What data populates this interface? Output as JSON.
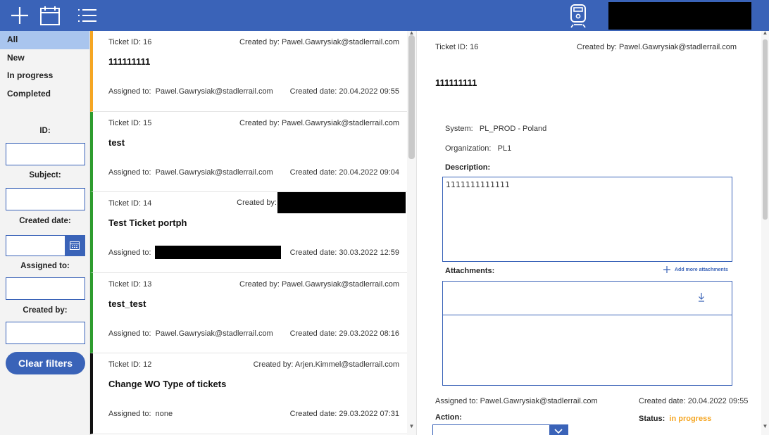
{
  "topbar": {
    "icons": [
      "plus-icon",
      "calendar-icon",
      "list-icon",
      "train-icon"
    ],
    "color": "#3a63b8"
  },
  "filters": {
    "statuses": [
      "All",
      "New",
      "In progress",
      "Completed"
    ],
    "active_status": "All",
    "id_label": "ID:",
    "subject_label": "Subject:",
    "created_date_label": "Created date:",
    "assigned_to_label": "Assigned to:",
    "created_by_label": "Created by:",
    "clear_button": "Clear filters"
  },
  "tickets": [
    {
      "id_text": "Ticket ID: 16",
      "created_by": "Created by: Pawel.Gawrysiak@stadlerrail.com",
      "subject": "111111111",
      "assigned_label": "Assigned to:",
      "assigned": "Pawel.Gawrysiak@stadlerrail.com",
      "created_date": "Created date: 20.04.2022 09:55",
      "status_color": "#f5a623"
    },
    {
      "id_text": "Ticket ID: 15",
      "created_by": "Created by: Pawel.Gawrysiak@stadlerrail.com",
      "subject": "test",
      "assigned_label": "Assigned to:",
      "assigned": "Pawel.Gawrysiak@stadlerrail.com",
      "created_date": "Created date: 20.04.2022 09:04",
      "status_color": "#2e9c2e"
    },
    {
      "id_text": "Ticket ID: 14",
      "created_by": "Created by:",
      "subject": "Test Ticket portph",
      "assigned_label": "Assigned to:",
      "assigned": "",
      "created_date": "Created date: 30.03.2022 12:59",
      "status_color": "#2e9c2e"
    },
    {
      "id_text": "Ticket ID: 13",
      "created_by": "Created by: Pawel.Gawrysiak@stadlerrail.com",
      "subject": "test_test",
      "assigned_label": "Assigned to:",
      "assigned": "Pawel.Gawrysiak@stadlerrail.com",
      "created_date": "Created date: 29.03.2022 08:16",
      "status_color": "#2e9c2e"
    },
    {
      "id_text": "Ticket ID: 12",
      "created_by": "Created by: Arjen.Kimmel@stadlerrail.com",
      "subject": "Change WO Type of tickets",
      "assigned_label": "Assigned to:",
      "assigned": "none",
      "created_date": "Created date: 29.03.2022 07:31",
      "status_color": "#111111"
    }
  ],
  "detail": {
    "ticket_id": "Ticket ID: 16",
    "created_by": "Created by: Pawel.Gawrysiak@stadlerrail.com",
    "title": "111111111",
    "system_label": "System:",
    "system": "PL_PROD - Poland",
    "organization_label": "Organization:",
    "organization": "PL1",
    "description_label": "Description:",
    "description": "1111111111111",
    "attachments_label": "Attachments:",
    "add_attachments": "Add more attachments",
    "assigned_to": "Assigned to: Pawel.Gawrysiak@stadlerrail.com",
    "created_date": "Created date: 20.04.2022 09:55",
    "action_label": "Action:",
    "status_label": "Status:",
    "status": "in progress"
  }
}
